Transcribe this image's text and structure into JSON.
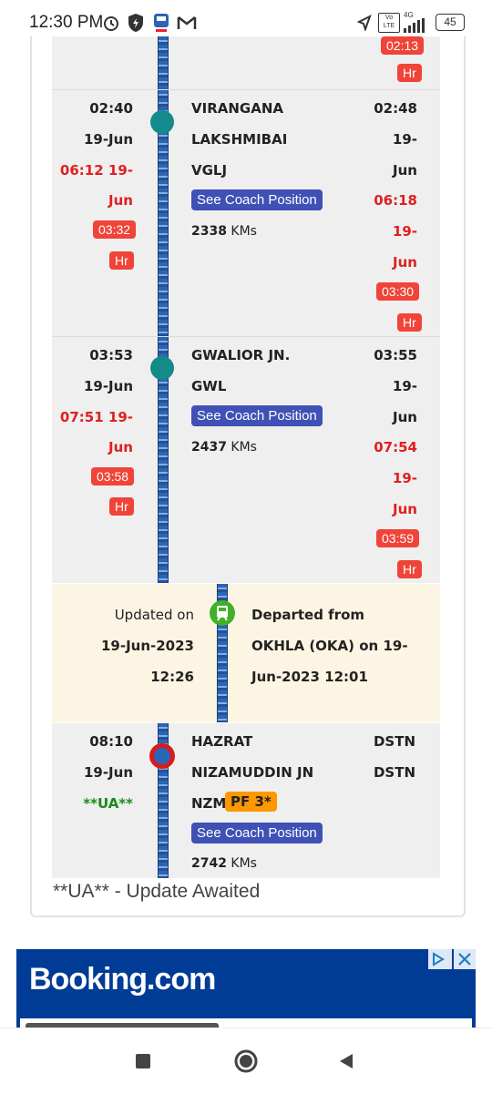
{
  "status_bar": {
    "time": "12:30 PM",
    "battery": "45",
    "network": "4G",
    "volte": "Vo LTE"
  },
  "prev_station": {
    "delay_time": "02:13",
    "delay_unit": "Hr"
  },
  "stations": [
    {
      "arr_time": "02:40",
      "arr_date": "19-Jun",
      "arr_actual_a": "06:12 19-",
      "arr_actual_b": "Jun",
      "arr_delay": "03:32",
      "arr_delay_unit": "Hr",
      "name_line1": "VIRANGANA",
      "name_line2": "LAKSHMIBAI",
      "code": "VGLJ",
      "coach_btn": "See Coach Position",
      "km_value": "2338",
      "km_unit": "KMs",
      "dep_time": "02:48",
      "dep_date_a": "19-",
      "dep_date_b": "Jun",
      "dep_actual_a": "06:18",
      "dep_actual_b": "19-",
      "dep_actual_c": "Jun",
      "dep_delay": "03:30",
      "dep_delay_unit": "Hr"
    },
    {
      "arr_time": "03:53",
      "arr_date": "19-Jun",
      "arr_actual_a": "07:51 19-",
      "arr_actual_b": "Jun",
      "arr_delay": "03:58",
      "arr_delay_unit": "Hr",
      "name_line1": "GWALIOR JN.",
      "code": "GWL",
      "coach_btn": "See Coach Position",
      "km_value": "2437",
      "km_unit": "KMs",
      "dep_time": "03:55",
      "dep_date_a": "19-",
      "dep_date_b": "Jun",
      "dep_actual_a": "07:54",
      "dep_actual_b": "19-",
      "dep_actual_c": "Jun",
      "dep_delay": "03:59",
      "dep_delay_unit": "Hr"
    }
  ],
  "update": {
    "label": "Updated on",
    "date": "19-Jun-2023",
    "time": "12:26",
    "line1": "Departed from",
    "line2": "OKHLA (OKA) on 19-",
    "line3": "Jun-2023 12:01"
  },
  "destination": {
    "arr_time": "08:10",
    "arr_date": "19-Jun",
    "status": "**UA**",
    "name_line1": "HAZRAT",
    "name_line2": "NIZAMUDDIN JN",
    "code": "NZM",
    "platform": "PF 3*",
    "coach_btn": "See Coach Position",
    "km_value": "2742",
    "km_unit": "KMs",
    "dep_a": "DSTN",
    "dep_b": "DSTN"
  },
  "legend_note": "**UA** - Update Awaited",
  "ad": {
    "brand": "Booking.com"
  },
  "colors": {
    "accent": "#3f51b5",
    "delay_red": "#f04438",
    "station_dot": "#148a8a",
    "update_bg": "#fdf5e4",
    "ad_bg": "#003b95",
    "ua_green": "#1a8a1a"
  },
  "icons": {
    "alarm": "alarm-icon",
    "shield": "shield-icon",
    "train": "train-icon",
    "gmail": "gmail-icon",
    "location": "location-icon",
    "signal": "signal-icon",
    "battery": "battery-icon",
    "back": "back-icon",
    "home": "home-icon",
    "recents": "recents-icon"
  }
}
